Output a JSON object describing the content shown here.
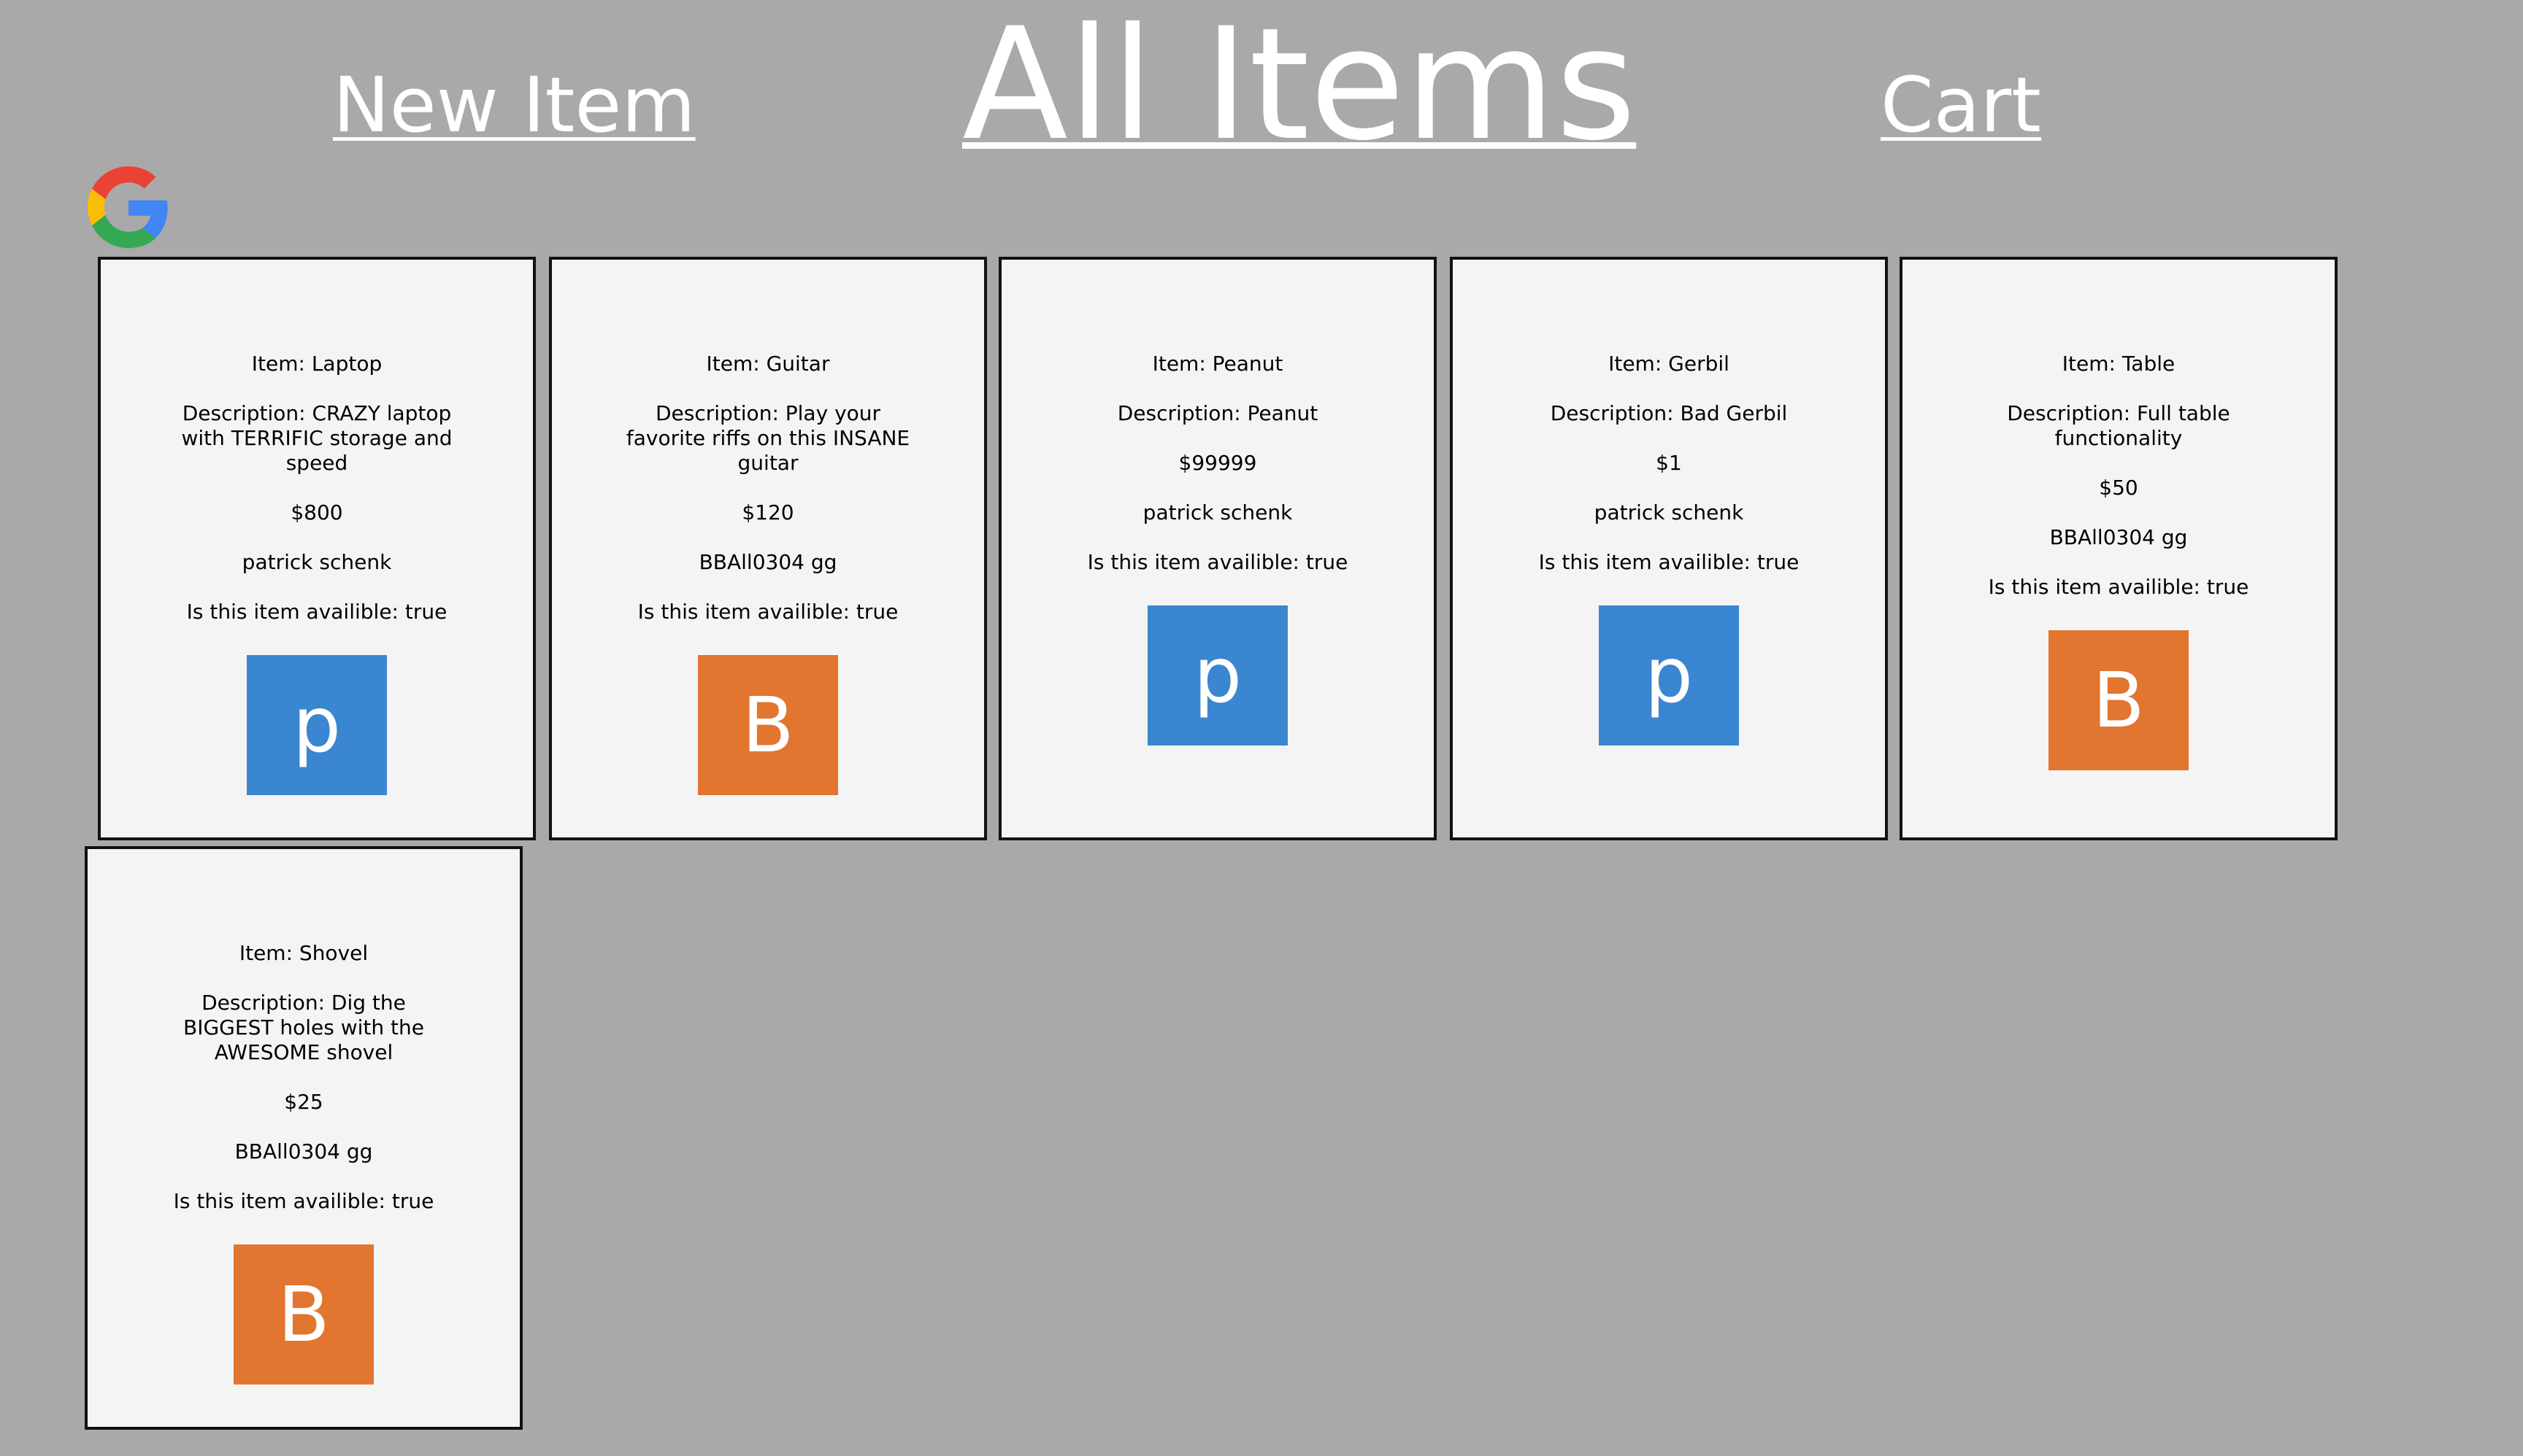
{
  "header": {
    "new_item_label": "New Item",
    "title": "All Items",
    "cart_label": "Cart"
  },
  "colors": {
    "page_background": "#a9a9a9",
    "card_background": "#f4f4f4",
    "avatar_blue": "#3b86d0",
    "avatar_orange": "#e27530"
  },
  "items": [
    {
      "item": "Item: Laptop",
      "description": "Description: CRAZY laptop with TERRIFIC storage and speed",
      "price": "$800",
      "seller": "patrick schenk",
      "available": "Is this item availible: true",
      "avatar_letter": "p",
      "avatar_color": "#3b86d0"
    },
    {
      "item": "Item: Guitar",
      "description": "Description: Play your favorite riffs on this INSANE guitar",
      "price": "$120",
      "seller": "BBAll0304 gg",
      "available": "Is this item availible: true",
      "avatar_letter": "B",
      "avatar_color": "#e27530"
    },
    {
      "item": "Item: Peanut",
      "description": "Description: Peanut",
      "price": "$99999",
      "seller": "patrick schenk",
      "available": "Is this item availible: true",
      "avatar_letter": "p",
      "avatar_color": "#3b86d0"
    },
    {
      "item": "Item: Gerbil",
      "description": "Description: Bad Gerbil",
      "price": "$1",
      "seller": "patrick schenk",
      "available": "Is this item availible: true",
      "avatar_letter": "p",
      "avatar_color": "#3b86d0"
    },
    {
      "item": "Item: Table",
      "description": "Description: Full table functionality",
      "price": "$50",
      "seller": "BBAll0304 gg",
      "available": "Is this item availible: true",
      "avatar_letter": "B",
      "avatar_color": "#e27530"
    },
    {
      "item": "Item: Shovel",
      "description": "Description: Dig the BIGGEST holes with the AWESOME shovel",
      "price": "$25",
      "seller": "BBAll0304 gg",
      "available": "Is this item availible: true",
      "avatar_letter": "B",
      "avatar_color": "#e27530"
    }
  ]
}
